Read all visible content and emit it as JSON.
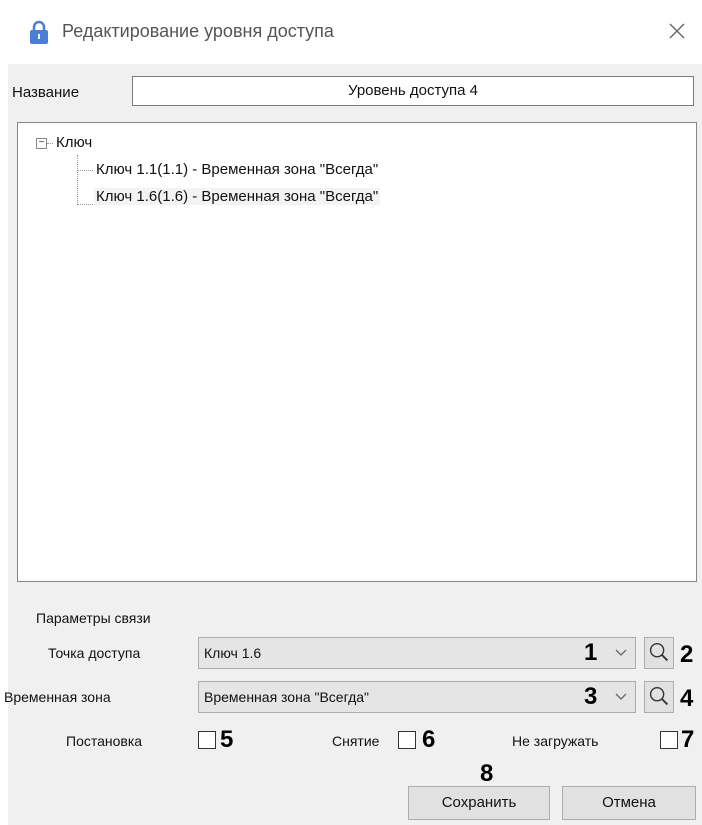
{
  "window": {
    "title": "Редактирование уровня доступа",
    "lock_icon": "lock-icon",
    "close_icon": "close-icon"
  },
  "name_field": {
    "label": "Название",
    "value": "Уровень доступа 4"
  },
  "tree": {
    "root": "Ключ",
    "children": [
      "Ключ 1.1(1.1) - Временная зона \"Всегда\"",
      "Ключ 1.6(1.6) - Временная зона \"Всегда\""
    ],
    "selected_index": 1
  },
  "connection_params": {
    "group_label": "Параметры связи",
    "access_point": {
      "label": "Точка доступа",
      "value": "Ключ 1.6",
      "callout": "1",
      "search_callout": "2"
    },
    "time_zone": {
      "label": "Временная зона",
      "value": "Временная зона \"Всегда\"",
      "callout": "3",
      "search_callout": "4"
    },
    "arm": {
      "label": "Постановка",
      "checked": false,
      "callout": "5"
    },
    "disarm": {
      "label": "Снятие",
      "checked": false,
      "callout": "6"
    },
    "no_load": {
      "label": "Не загружать",
      "checked": false,
      "callout": "7"
    }
  },
  "buttons": {
    "save": "Сохранить",
    "save_callout": "8",
    "cancel": "Отмена"
  },
  "colors": {
    "lock_icon": "#4a7fd4",
    "window_bg": "#f0f0f0",
    "combo_bg": "#e5e5e5",
    "selected_row": "#f3f3f3"
  }
}
